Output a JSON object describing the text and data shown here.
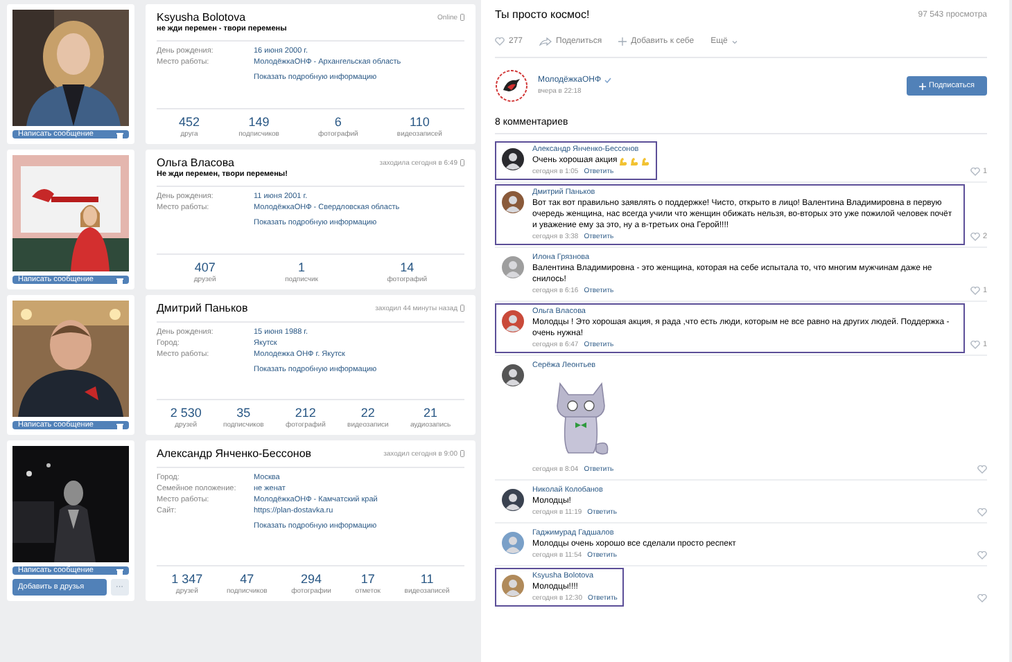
{
  "profiles": [
    {
      "name": "Ksyusha Bolotova",
      "status": "не жди перемен - твори перемены",
      "last_seen": "Online",
      "fields": [
        {
          "label": "День рождения:",
          "value": "16 июня 2000 г."
        },
        {
          "label": "Место работы:",
          "value": "МолодёжкаОНФ - Архангельская область"
        }
      ],
      "more_link": "Показать подробную информацию",
      "counters": [
        {
          "value": "452",
          "label": "друга"
        },
        {
          "value": "149",
          "label": "подписчиков"
        },
        {
          "value": "6",
          "label": "фотографий"
        },
        {
          "value": "110",
          "label": "видеозаписей"
        }
      ],
      "buttons": [
        {
          "label": "Написать сообщение",
          "kind": "message"
        }
      ]
    },
    {
      "name": "Ольга Власова",
      "status": "Не жди перемен, твори перемены!",
      "last_seen": "заходила сегодня в 6:49",
      "fields": [
        {
          "label": "День рождения:",
          "value": "11 июня 2001 г."
        },
        {
          "label": "Место работы:",
          "value": "МолодёжкаОНФ - Свердловская область"
        }
      ],
      "more_link": "Показать подробную информацию",
      "counters": [
        {
          "value": "407",
          "label": "друзей"
        },
        {
          "value": "1",
          "label": "подписчик"
        },
        {
          "value": "14",
          "label": "фотографий"
        }
      ],
      "buttons": [
        {
          "label": "Написать сообщение",
          "kind": "message"
        }
      ]
    },
    {
      "name": "Дмитрий Паньков",
      "last_seen": "заходил 44 минуты назад",
      "fields": [
        {
          "label": "День рождения:",
          "value": "15 июня 1988 г."
        },
        {
          "label": "Город:",
          "value": "Якутск"
        },
        {
          "label": "Место работы:",
          "value": "Молодежка ОНФ г. Якутск"
        }
      ],
      "more_link": "Показать подробную информацию",
      "counters": [
        {
          "value": "2 530",
          "label": "друзей"
        },
        {
          "value": "35",
          "label": "подписчиков"
        },
        {
          "value": "212",
          "label": "фотографий"
        },
        {
          "value": "22",
          "label": "видеозаписи"
        },
        {
          "value": "21",
          "label": "аудиозапись"
        }
      ],
      "buttons": [
        {
          "label": "Написать сообщение",
          "kind": "message"
        }
      ]
    },
    {
      "name": "Александр Янченко-Бессонов",
      "last_seen": "заходил сегодня в 9:00",
      "fields": [
        {
          "label": "Город:",
          "value": "Москва"
        },
        {
          "label": "Семейное положение:",
          "value": "не женат"
        },
        {
          "label": "Место работы:",
          "value": "МолодёжкаОНФ - Камчатский край"
        },
        {
          "label": "Сайт:",
          "value": "https://plan-dostavka.ru"
        }
      ],
      "more_link": "Показать подробную информацию",
      "counters": [
        {
          "value": "1 347",
          "label": "друзей"
        },
        {
          "value": "47",
          "label": "подписчиков"
        },
        {
          "value": "294",
          "label": "фотографии"
        },
        {
          "value": "17",
          "label": "отметок"
        },
        {
          "value": "11",
          "label": "видеозаписей"
        }
      ],
      "buttons": [
        {
          "label": "Написать сообщение",
          "kind": "message"
        },
        {
          "label": "Добавить в друзья",
          "kind": "add"
        },
        {
          "label": "···",
          "kind": "more"
        }
      ]
    }
  ],
  "video": {
    "title": "Ты просто космос!",
    "views": "97 543 просмотра",
    "likes": "277",
    "share": "Поделиться",
    "add": "Добавить к себе",
    "more": "Ещё",
    "channel": {
      "name": "МолодёжкаОНФ",
      "verified": true,
      "time": "вчера в 22:18",
      "subscribe": "Подписаться"
    },
    "comments_header": "8 комментариев",
    "comments": [
      {
        "kind": "text",
        "author": "Александр Янченко-Бессонов",
        "text": "Очень хорошая акция",
        "emojis": [
          {
            "kind": "arm"
          },
          {
            "kind": "arm"
          },
          {
            "kind": "arm"
          }
        ],
        "time": "сегодня в 1:05",
        "reply": "Ответить",
        "likes": "1",
        "highlighted": true
      },
      {
        "kind": "text",
        "author": "Дмитрий Паньков",
        "text": "Вот так вот правильно заявлять о поддержке! Чисто, открыто в лицо! Валентина Владимировна в первую очередь женщина, нас всегда учили что женщин обижать нельзя, во-вторых это уже пожилой человек почёт и уважение ему за это, ну а в-третьих она Герой!!!!",
        "time": "сегодня в 3:38",
        "reply": "Ответить",
        "likes": "2",
        "highlighted": true
      },
      {
        "kind": "text",
        "author": "Илона Грязнова",
        "text": "Валентина Владимировна - это женщина, которая на себе испытала то, что многим мужчинам даже не снилось!",
        "time": "сегодня в 6:16",
        "reply": "Ответить",
        "likes": "1",
        "highlighted": false
      },
      {
        "kind": "text",
        "author": "Ольга Власова",
        "text": "Молодцы ! Это хорошая акция, я рада ,что есть люди, которым не все равно на других людей. Поддержка - очень нужна!",
        "time": "сегодня в 6:47",
        "reply": "Ответить",
        "likes": "1",
        "highlighted": true
      },
      {
        "kind": "sticker",
        "author": "Серёжа Леонтьев",
        "time": "сегодня в 8:04",
        "reply": "Ответить",
        "highlighted": false
      },
      {
        "kind": "text",
        "author": "Николай Колобанов",
        "text": "Молодцы!",
        "time": "сегодня в 11:19",
        "reply": "Ответить",
        "highlighted": false
      },
      {
        "kind": "text",
        "author": "Гаджимурад Гадшалов",
        "text": "Молодцы очень хорошо все сделали просто респект",
        "time": "сегодня в 11:54",
        "reply": "Ответить",
        "highlighted": false
      },
      {
        "kind": "text",
        "author": "Ksyusha Bolotova",
        "text": "Молодцы!!!!",
        "time": "сегодня в 12:30",
        "reply": "Ответить",
        "highlighted": true
      }
    ]
  }
}
